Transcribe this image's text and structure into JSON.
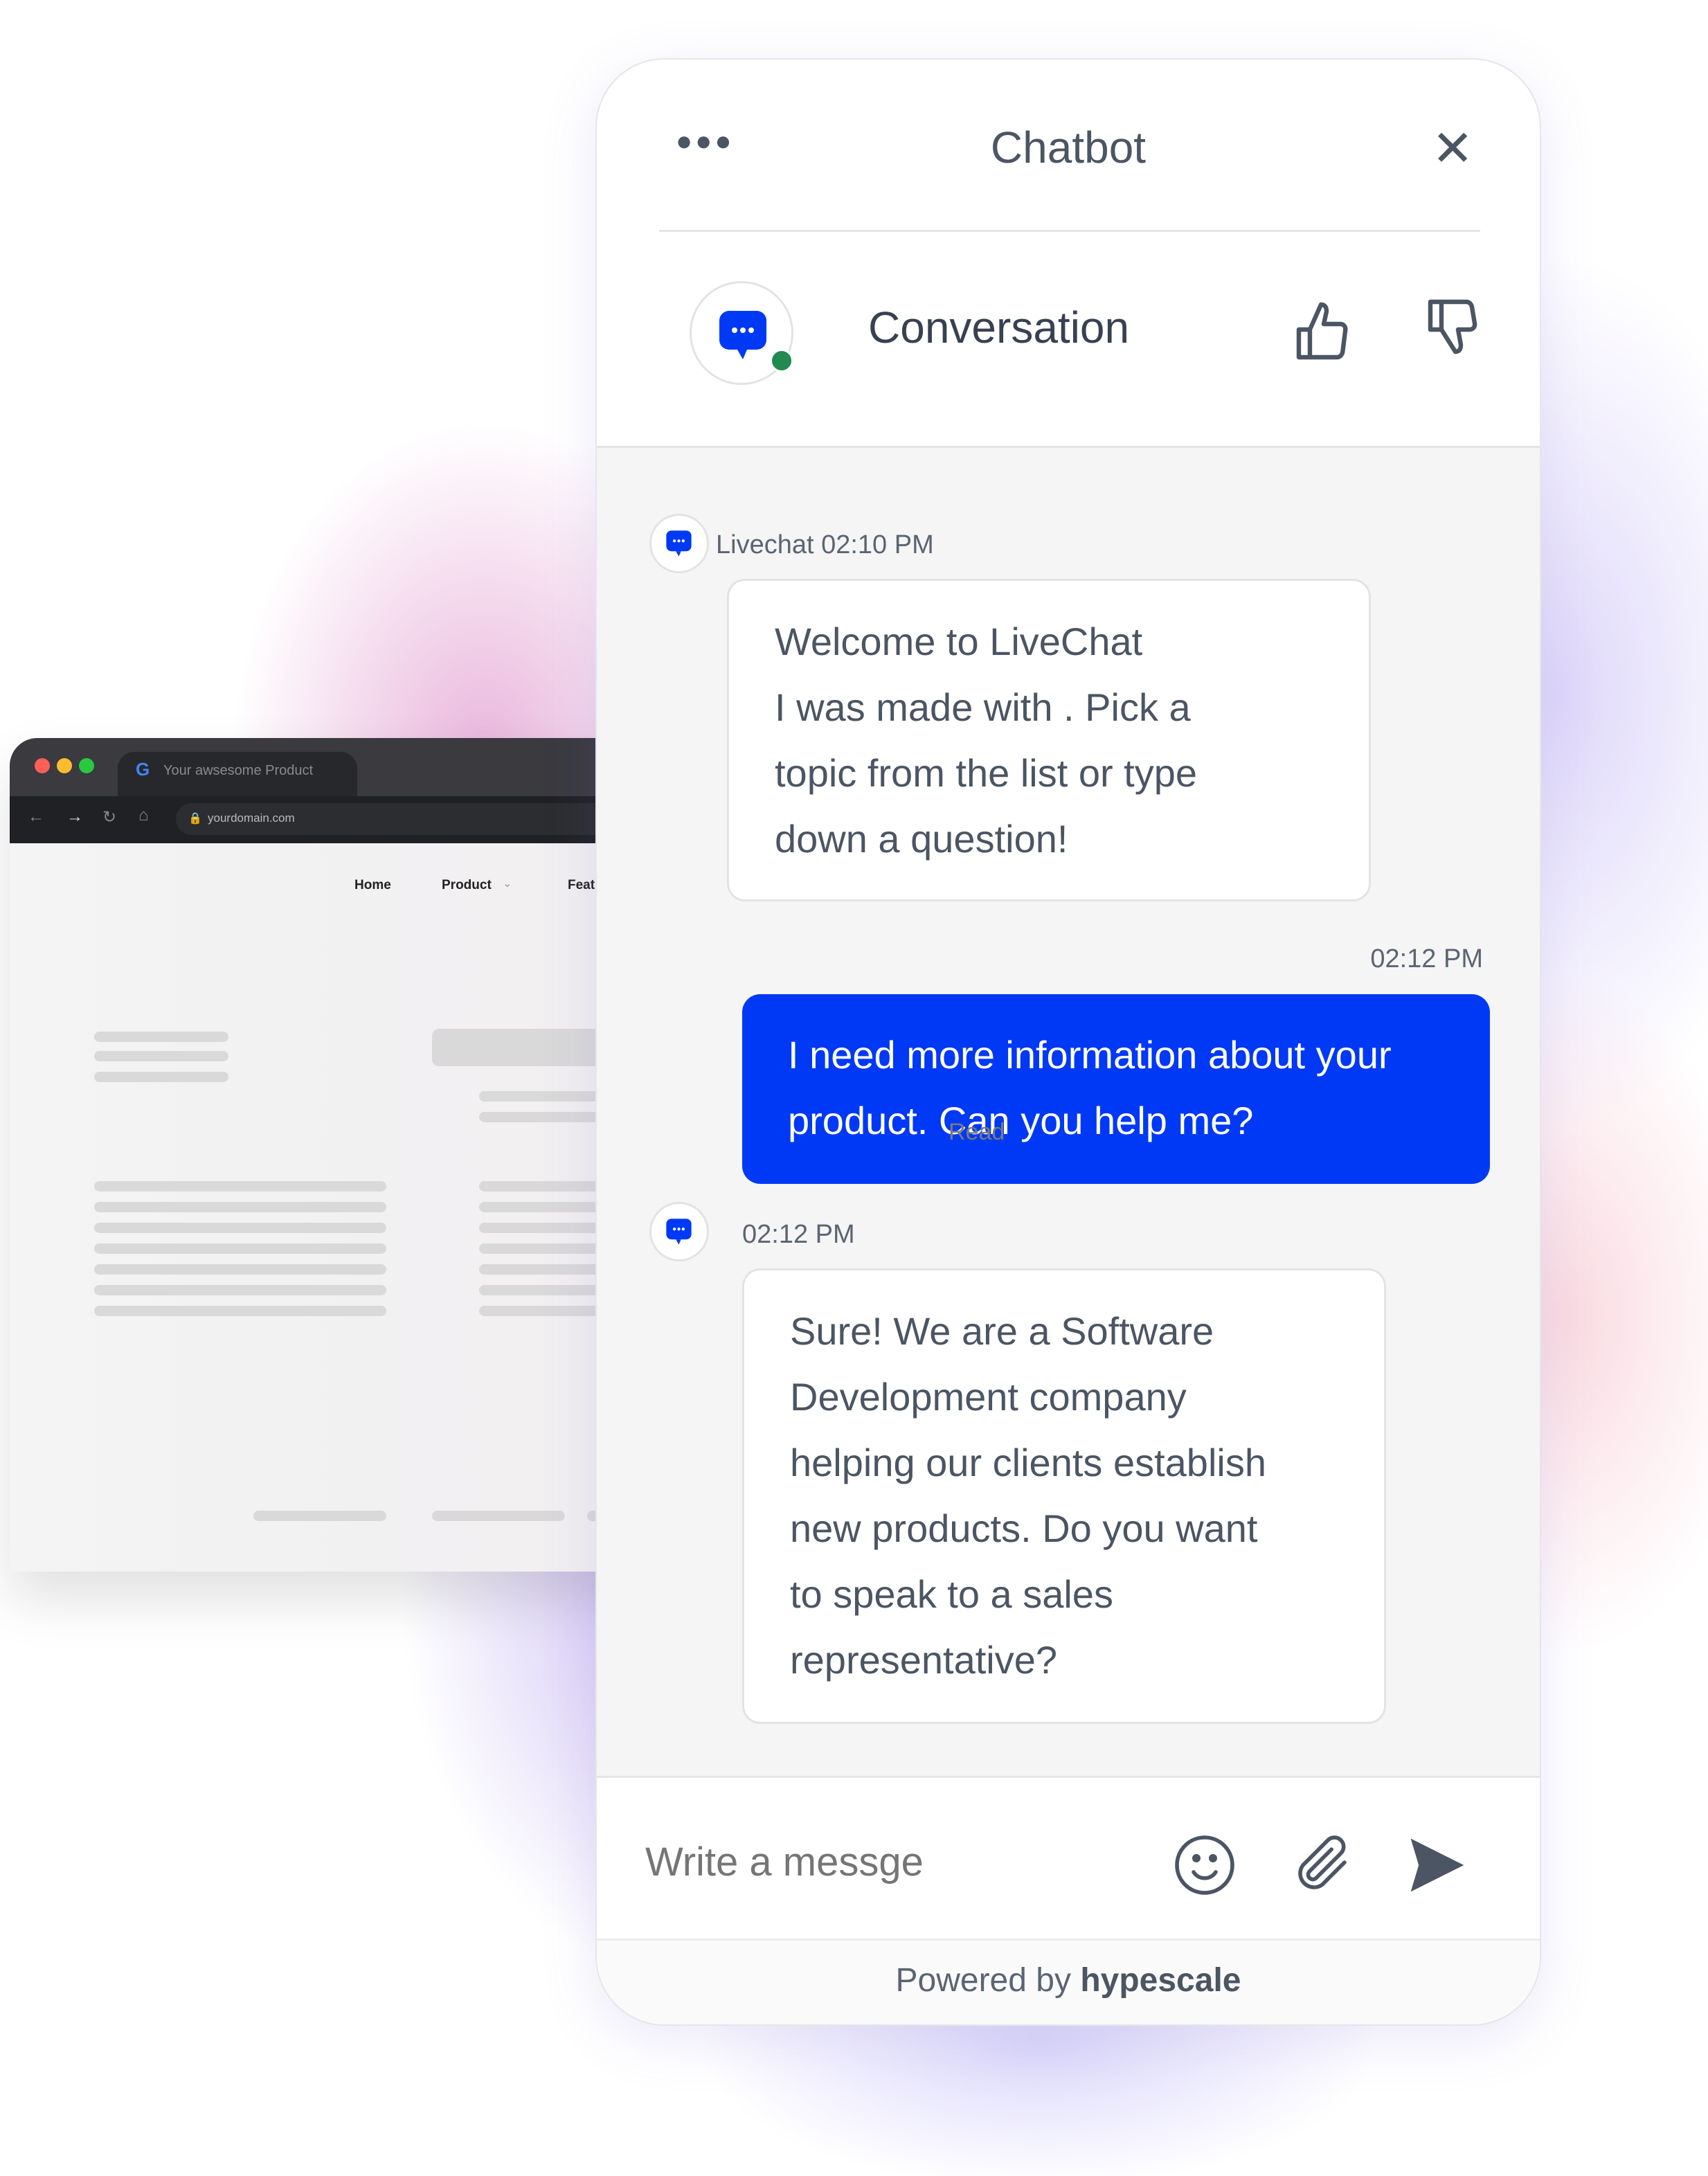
{
  "browser": {
    "tab_title": "Your awsesome Product",
    "url": "yourdomain.com",
    "nav": [
      "Home",
      "Product",
      "Feat"
    ]
  },
  "chat": {
    "title": "Chatbot",
    "conversation_title": "Conversation",
    "status_color": "#218a50",
    "accent": "#0039f5",
    "messages": [
      {
        "sender": "Livechat",
        "meta": "Livechat 02:10 PM",
        "lines": [
          "Welcome to LiveChat",
          "I was made with . Pick a",
          "topic from the list or type",
          "down a question!"
        ]
      },
      {
        "sender": "user",
        "meta": "02:12 PM",
        "lines": [
          "I need more information about your",
          "product. Can you help me?"
        ],
        "status": "Read"
      },
      {
        "sender": "bot",
        "meta": "02:12 PM",
        "lines": [
          "Sure! We are a Software",
          "Development company",
          "helping our clients establish",
          "new products. Do you want",
          "to speak to a sales",
          "representative?"
        ]
      }
    ],
    "input_placeholder": "Write a messge",
    "footer_prefix": "Powered by",
    "footer_brand": "hypescale"
  }
}
